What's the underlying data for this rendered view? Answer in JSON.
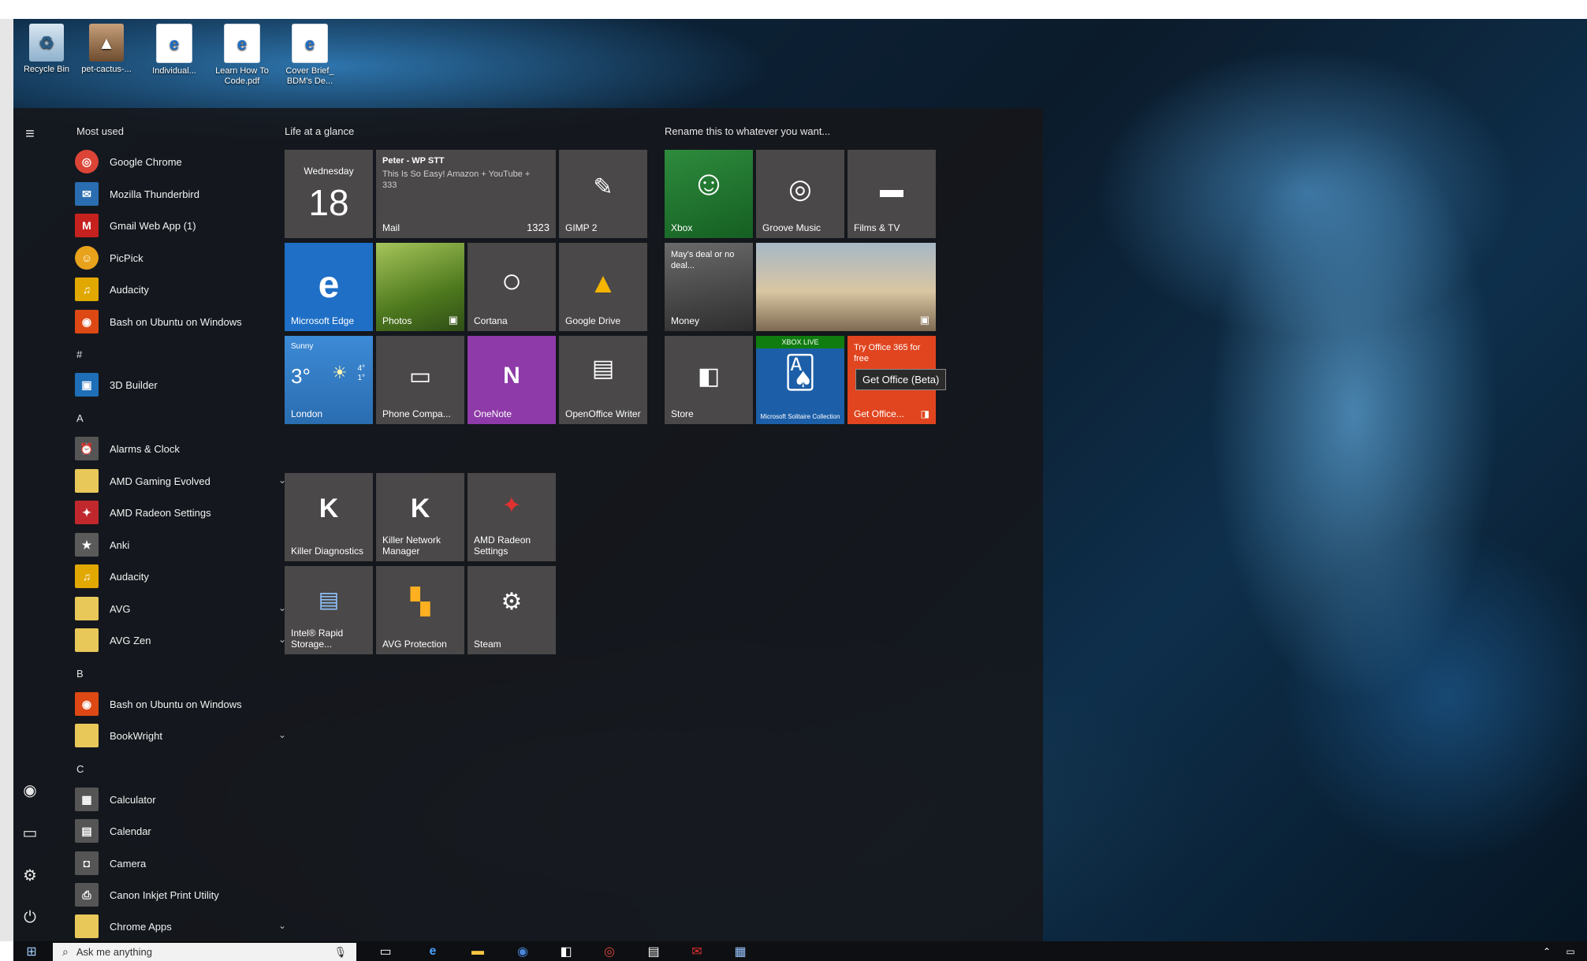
{
  "desktop": {
    "icons": [
      {
        "label": "Recycle Bin",
        "icon": "recycle-bin-icon"
      },
      {
        "label": "pet-cactus-...",
        "icon": "image-file-icon"
      },
      {
        "label": "Individual...",
        "icon": "pdf-file-icon"
      },
      {
        "label": "Learn How To Code.pdf",
        "icon": "pdf-file-icon"
      },
      {
        "label": "Cover Brief_ BDM's De...",
        "icon": "pdf-file-icon"
      }
    ]
  },
  "start_menu": {
    "most_used_label": "Most used",
    "most_used": [
      {
        "label": "Google Chrome",
        "icon": "chrome-icon",
        "color": "#db4437"
      },
      {
        "label": "Mozilla Thunderbird",
        "icon": "thunderbird-icon",
        "color": "#2a6db0"
      },
      {
        "label": "Gmail Web App (1)",
        "icon": "gmail-icon",
        "color": "#c5221f"
      },
      {
        "label": "PicPick",
        "icon": "picpick-icon",
        "color": "#e8a21b"
      },
      {
        "label": "Audacity",
        "icon": "audacity-icon",
        "color": "#e0a800"
      },
      {
        "label": "Bash on Ubuntu on Windows",
        "icon": "ubuntu-icon",
        "color": "#dd4814"
      }
    ],
    "sections": [
      {
        "letter": "#",
        "apps": [
          {
            "label": "3D Builder",
            "icon": "3d-builder-icon",
            "color": "#1e6fb8"
          }
        ]
      },
      {
        "letter": "A",
        "apps": [
          {
            "label": "Alarms & Clock",
            "icon": "alarm-clock-icon",
            "color": "#555555"
          },
          {
            "label": "AMD Gaming Evolved",
            "icon": "folder-icon",
            "color": "#e9c85a",
            "chevron": "⌄"
          },
          {
            "label": "AMD Radeon Settings",
            "icon": "amd-radeon-icon",
            "color": "#c0282d"
          },
          {
            "label": "Anki",
            "icon": "anki-icon",
            "color": "#5a5a5a"
          },
          {
            "label": "Audacity",
            "icon": "audacity-icon",
            "color": "#e0a800"
          },
          {
            "label": "AVG",
            "icon": "folder-icon",
            "color": "#e9c85a",
            "chevron": "⌄"
          },
          {
            "label": "AVG Zen",
            "icon": "folder-icon",
            "color": "#e9c85a",
            "chevron": "⌄"
          }
        ]
      },
      {
        "letter": "B",
        "apps": [
          {
            "label": "Bash on Ubuntu on Windows",
            "icon": "ubuntu-icon",
            "color": "#dd4814"
          },
          {
            "label": "BookWright",
            "icon": "folder-icon",
            "color": "#e9c85a",
            "chevron": "⌄"
          }
        ]
      },
      {
        "letter": "C",
        "apps": [
          {
            "label": "Calculator",
            "icon": "calculator-icon",
            "color": "#555555"
          },
          {
            "label": "Calendar",
            "icon": "calendar-icon",
            "color": "#555555"
          },
          {
            "label": "Camera",
            "icon": "camera-icon",
            "color": "#555555"
          },
          {
            "label": "Canon Inkjet Print Utility",
            "icon": "printer-icon",
            "color": "#555555"
          },
          {
            "label": "Chrome Apps",
            "icon": "folder-icon",
            "color": "#e9c85a",
            "chevron": "⌄"
          }
        ]
      }
    ],
    "groups": {
      "life_at_a_glance": "Life at a glance",
      "rename": "Rename this to whatever you want..."
    },
    "tiles": {
      "calendar": {
        "day": "Wednesday",
        "date": "18"
      },
      "mail": {
        "from": "Peter - WP STT",
        "preview": "This Is So Easy! Amazon + YouTube + 333",
        "label": "Mail",
        "count": "1323"
      },
      "gimp": {
        "label": "GIMP 2"
      },
      "xbox": {
        "label": "Xbox"
      },
      "groove": {
        "label": "Groove Music"
      },
      "films": {
        "label": "Films & TV"
      },
      "edge": {
        "label": "Microsoft Edge"
      },
      "photos": {
        "label": "Photos"
      },
      "cortana": {
        "label": "Cortana"
      },
      "google_drive": {
        "label": "Google Drive"
      },
      "money": {
        "headline": "May's deal or no deal...",
        "label": "Money"
      },
      "weather": {
        "condition": "Sunny",
        "temp": "3°",
        "high": "4°",
        "low": "1°",
        "label": "London"
      },
      "phone": {
        "label": "Phone Compa..."
      },
      "onenote": {
        "label": "OneNote"
      },
      "openoffice": {
        "label": "OpenOffice Writer"
      },
      "store": {
        "label": "Store"
      },
      "solitaire": {
        "badge": "XBOX LIVE",
        "label": "Microsoft Solitaire Collection"
      },
      "office": {
        "promo": "Try Office 365 for free",
        "label": "Get Office..."
      },
      "killer_diag": {
        "label": "Killer Diagnostics"
      },
      "killer_net": {
        "label": "Killer Network Manager"
      },
      "amd_tile": {
        "label": "AMD Radeon Settings"
      },
      "intel": {
        "label": "Intel® Rapid Storage..."
      },
      "avg_protection": {
        "label": "AVG Protection"
      },
      "steam": {
        "label": "Steam"
      }
    },
    "tooltip": "Get Office (Beta)"
  },
  "taskbar": {
    "search_placeholder": "Ask me anything"
  }
}
